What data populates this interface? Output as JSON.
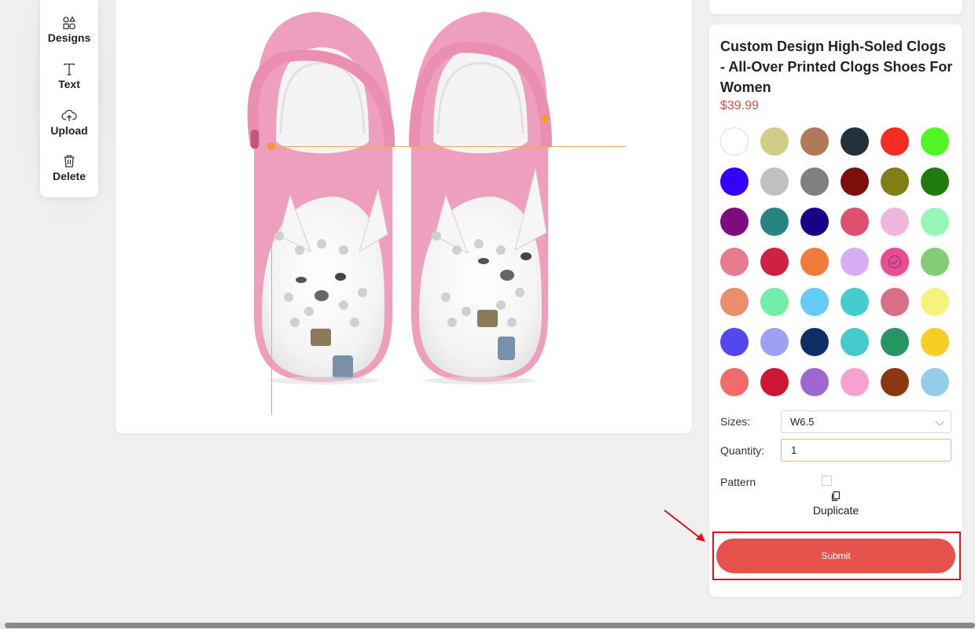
{
  "toolbar": {
    "items": [
      {
        "label": "Designs",
        "icon": "shapes-icon"
      },
      {
        "label": "Text",
        "icon": "text-icon"
      },
      {
        "label": "Upload",
        "icon": "cloud-upload-icon"
      },
      {
        "label": "Delete",
        "icon": "trash-icon"
      }
    ]
  },
  "product": {
    "title": "Custom Design High-Soled Clogs - All-Over Printed Clogs Shoes For Women",
    "price": "$39.99",
    "clog_color": "#ef9fbe"
  },
  "colors": [
    "#ffffff",
    "#d0cd87",
    "#b07a5a",
    "#23313b",
    "#f62b22",
    "#54f526",
    "#3600f8",
    "#c0c0c0",
    "#808080",
    "#7c0f0c",
    "#807f15",
    "#1f7b0d",
    "#7c0c7f",
    "#278482",
    "#1b0087",
    "#e04e70",
    "#eeb7db",
    "#99f6b9",
    "#e77a8f",
    "#cd2241",
    "#f07b3d",
    "#d7adf8",
    "#e94c94",
    "#82cd75",
    "#ea8e6c",
    "#73eda9",
    "#64cbf5",
    "#44cdcc",
    "#d96e87",
    "#f5f27e",
    "#5547ee",
    "#9e9ff5",
    "#122e67",
    "#45cbcb",
    "#269463",
    "#f8cd25",
    "#f26a6a",
    "#cb1634",
    "#9d67d2",
    "#f6a1cf",
    "#8b3810",
    "#94cde9"
  ],
  "selected_color_index": 22,
  "form": {
    "sizes_label": "Sizes:",
    "size_value": "W6.5",
    "quantity_label": "Quantity:",
    "quantity_value": "1",
    "pattern_label": "Pattern",
    "duplicate_label": "Duplicate",
    "submit_label": "Submit"
  }
}
